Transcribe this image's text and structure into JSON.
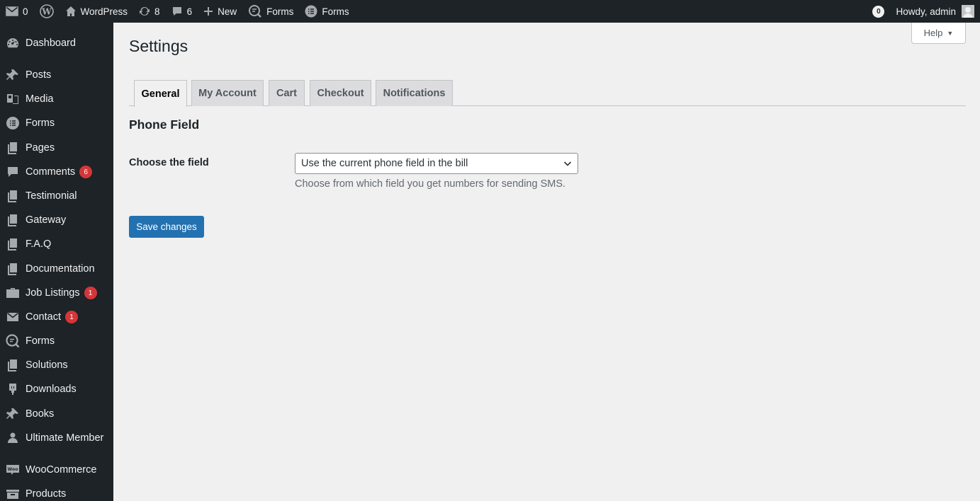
{
  "adminbar": {
    "messages_count": "0",
    "site_name": "WordPress",
    "updates_count": "8",
    "comments_count": "6",
    "new_label": "New",
    "forms_label_1": "Forms",
    "forms_label_2": "Forms",
    "notification_count": "0",
    "howdy": "Howdy, admin"
  },
  "sidebar": {
    "items": [
      {
        "label": "Dashboard",
        "icon": "dashboard-icon"
      },
      {
        "label": "Posts",
        "icon": "pin-icon"
      },
      {
        "label": "Media",
        "icon": "media-icon"
      },
      {
        "label": "Forms",
        "icon": "forms-icon"
      },
      {
        "label": "Pages",
        "icon": "page-icon"
      },
      {
        "label": "Comments",
        "icon": "comment-icon",
        "badge": "6"
      },
      {
        "label": "Testimonial",
        "icon": "page-icon"
      },
      {
        "label": "Gateway",
        "icon": "page-icon"
      },
      {
        "label": "F.A.Q",
        "icon": "page-icon"
      },
      {
        "label": "Documentation",
        "icon": "page-icon"
      },
      {
        "label": "Job Listings",
        "icon": "briefcase-icon",
        "badge": "1"
      },
      {
        "label": "Contact",
        "icon": "mail-icon",
        "badge": "1"
      },
      {
        "label": "Forms",
        "icon": "forms-search-icon"
      },
      {
        "label": "Solutions",
        "icon": "page-icon"
      },
      {
        "label": "Downloads",
        "icon": "download-icon"
      },
      {
        "label": "Books",
        "icon": "pin-icon"
      },
      {
        "label": "Ultimate Member",
        "icon": "user-icon"
      },
      {
        "label": "WooCommerce",
        "icon": "woo-icon"
      },
      {
        "label": "Products",
        "icon": "archive-icon"
      }
    ]
  },
  "main": {
    "help_label": "Help",
    "page_title": "Settings",
    "tabs": [
      {
        "label": "General",
        "active": true
      },
      {
        "label": "My Account",
        "active": false
      },
      {
        "label": "Cart",
        "active": false
      },
      {
        "label": "Checkout",
        "active": false
      },
      {
        "label": "Notifications",
        "active": false
      }
    ],
    "section_title": "Phone Field",
    "field_label": "Choose the field",
    "field_selected": "Use the current phone field in the bill",
    "field_description": "Choose from which field you get numbers for sending SMS.",
    "save_label": "Save changes"
  },
  "colors": {
    "adminbar_bg": "#1d2327",
    "accent": "#2271b1",
    "badge": "#d63638"
  }
}
